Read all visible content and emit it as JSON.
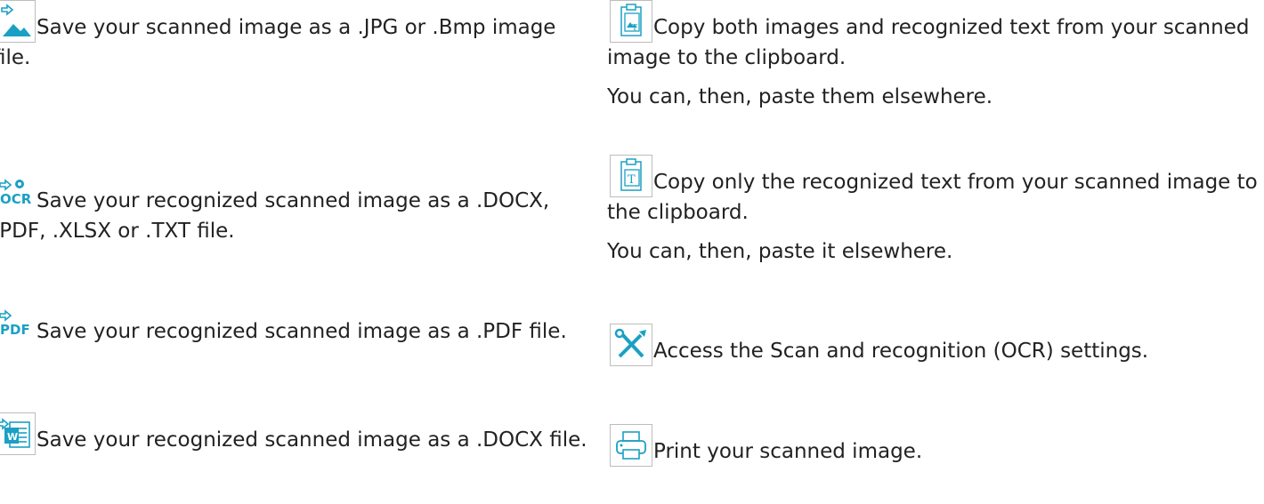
{
  "left": [
    {
      "icon": "save-image-icon",
      "text": "Save your scanned image as a .JPG or .Bmp image file."
    },
    {
      "icon": "save-ocr-icon",
      "icon_label": "OCR",
      "text": "Save your recognized scanned image as a .DOCX, .PDF, .XLSX or .TXT file."
    },
    {
      "icon": "save-pdf-icon",
      "icon_label": "PDF",
      "text": "Save your recognized scanned image as a .PDF file."
    },
    {
      "icon": "save-word-icon",
      "icon_label": "W",
      "text": "Save your recognized scanned image as a .DOCX file."
    }
  ],
  "right": [
    {
      "icon": "copy-images-text-icon",
      "text": "Copy both images and recognized text from your scanned image to the clipboard.",
      "note": "You can, then, paste them elsewhere."
    },
    {
      "icon": "copy-text-icon",
      "icon_label": "T",
      "text": "Copy only the recognized text from your scanned image to the clipboard.",
      "note": "You can, then, paste it elsewhere."
    },
    {
      "icon": "settings-tools-icon",
      "text": "Access the Scan and recognition (OCR) settings."
    },
    {
      "icon": "print-icon",
      "text": "Print your scanned image."
    }
  ],
  "colors": {
    "accent": "#1ba0c4",
    "text": "#222222"
  }
}
